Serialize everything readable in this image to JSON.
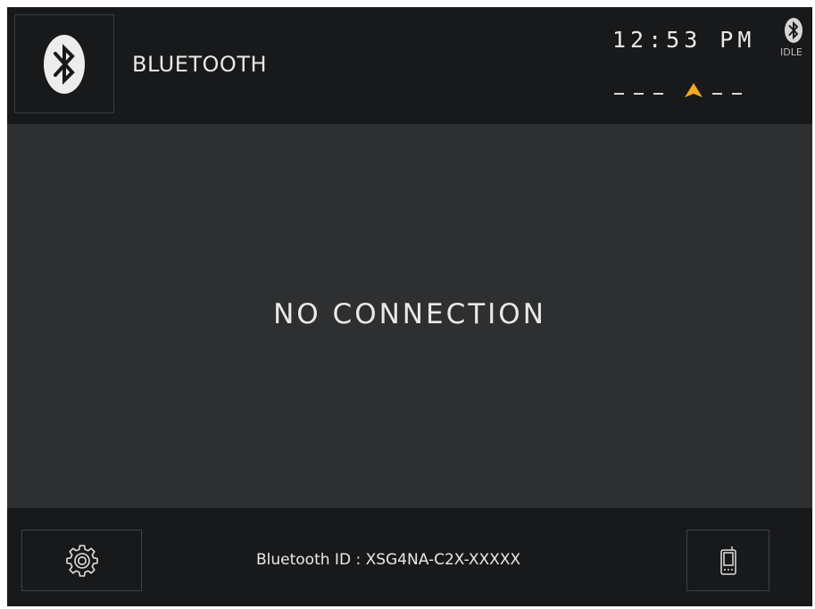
{
  "header": {
    "title": "BLUETOOTH",
    "clock": "12:53 PM",
    "bt_state": "IDLE",
    "compass": {
      "left_dashes": "– – –",
      "right_dashes": "– –",
      "arrow_color": "#f5a623"
    }
  },
  "main": {
    "status": "NO CONNECTION"
  },
  "footer": {
    "device_id": "Bluetooth ID : XSG4NA-C2X-XXXXX",
    "settings_icon": "gear-icon",
    "phone_icon": "phone-icon"
  },
  "colors": {
    "header_bg": "#18191b",
    "main_bg": "#2d2f30",
    "text": "#e9e9e9",
    "accent": "#f5a623"
  }
}
